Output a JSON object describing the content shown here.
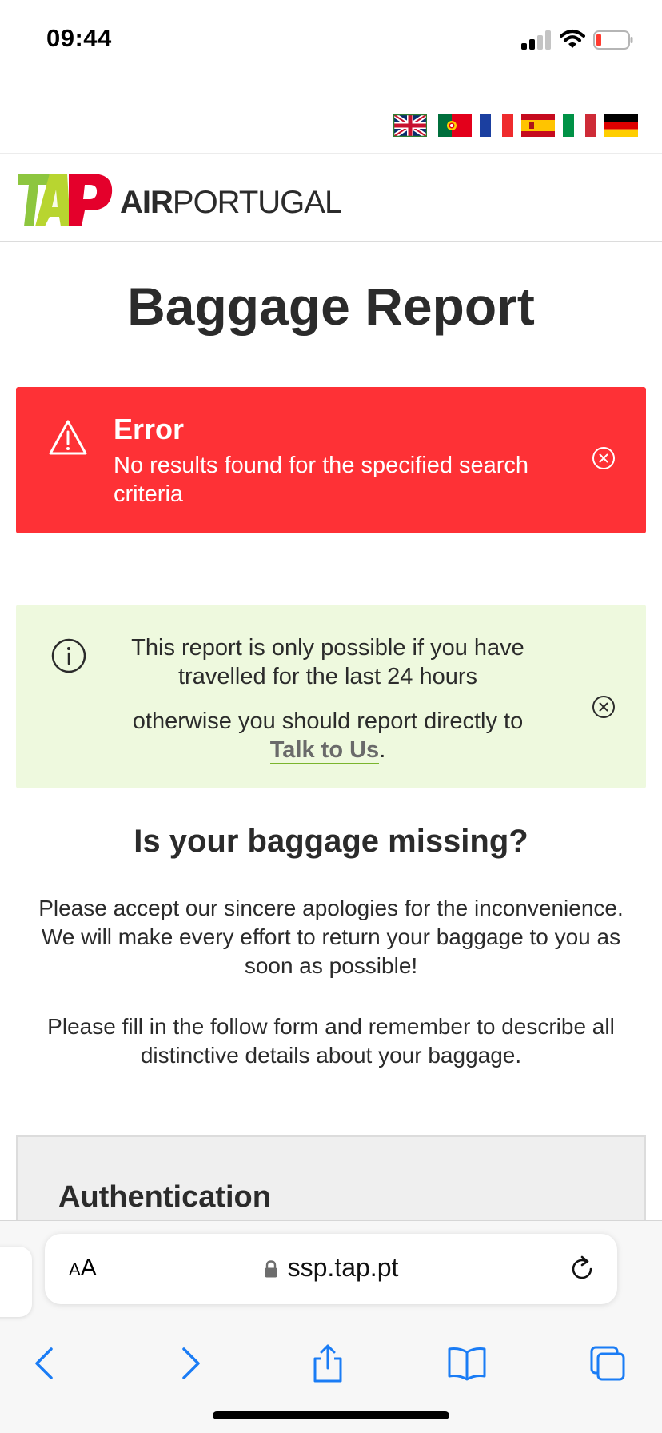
{
  "status_bar": {
    "time": "09:44"
  },
  "languages": [
    {
      "name": "flag-uk-icon"
    },
    {
      "name": "flag-portugal-icon"
    },
    {
      "name": "flag-france-icon"
    },
    {
      "name": "flag-spain-icon"
    },
    {
      "name": "flag-italy-icon"
    },
    {
      "name": "flag-germany-icon"
    }
  ],
  "brand": {
    "logo_text": "TAP",
    "air": "AIR",
    "portugal": "PORTUGAL"
  },
  "page": {
    "title": "Baggage Report"
  },
  "error_alert": {
    "title": "Error",
    "message": "No results found for the specified search criteria",
    "color": "#fe3136"
  },
  "info_alert": {
    "line1": "This report is only possible if you have travelled for the last 24 hours",
    "line2_prefix": "otherwise you should report directly to",
    "link": "Talk to Us",
    "line2_suffix": ".",
    "color": "#eef9de"
  },
  "missing_section": {
    "heading": "Is your baggage missing?",
    "paragraph1": "Please accept our sincere apologies for the inconvenience. We will make every effort to return your baggage to you as soon as possible!",
    "paragraph2": "Please fill in the follow form and remember to describe all distinctive details about your baggage."
  },
  "auth_section": {
    "title": "Authentication"
  },
  "browser": {
    "aa_label_small": "A",
    "aa_label_big": "A",
    "url": "ssp.tap.pt",
    "accent": "#1a7cf5"
  }
}
